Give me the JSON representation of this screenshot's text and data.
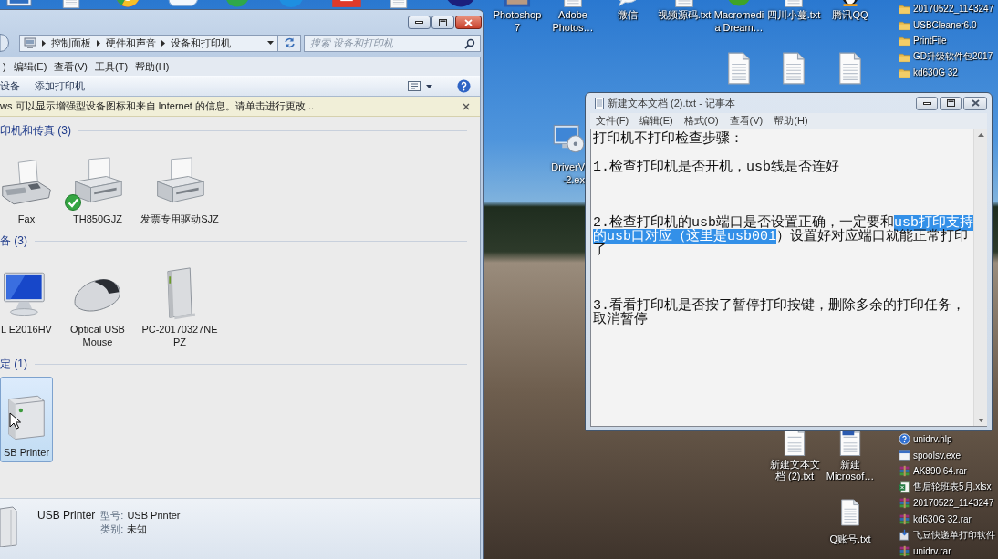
{
  "desktop": {
    "icons": [
      {
        "kind": "window"
      },
      {
        "kind": "document"
      },
      {
        "kind": "browser"
      },
      {
        "kind": "cloud"
      },
      {
        "kind": "orb",
        "color": "#2fa84a"
      },
      {
        "kind": "orb",
        "color": "#1e8fe0"
      },
      {
        "kind": "tile",
        "color": "#e03a2a"
      },
      {
        "kind": "document"
      },
      {
        "kind": "orb",
        "color": "#1b1f7c"
      },
      {
        "kind": "photo",
        "lines": [
          "Photoshop",
          "7"
        ]
      },
      {
        "kind": "document",
        "lines": [
          "Adobe",
          "Photos…"
        ]
      },
      {
        "kind": "bubble",
        "lines": [
          "微信"
        ]
      },
      {
        "kind": "document",
        "lines": [
          "视频源码.txt"
        ]
      },
      {
        "kind": "orb",
        "color": "#3fa428",
        "lines": [
          "Macromedi",
          "a Dream…"
        ]
      },
      {
        "kind": "document",
        "lines": [
          "四川小蔓.txt"
        ]
      },
      {
        "kind": "penguin",
        "lines": [
          "腾讯QQ"
        ]
      },
      {
        "kind": "document"
      },
      {
        "kind": "document"
      },
      {
        "kind": "document"
      },
      {
        "kind": "disc",
        "lines": [
          "DriverV",
          "-2.ex"
        ]
      },
      {
        "kind": "document",
        "lines": [
          "新建文本文",
          "档 (2).txt"
        ]
      },
      {
        "kind": "word",
        "lines": [
          "新建",
          "Microsof…"
        ]
      },
      {
        "kind": "document",
        "lines": [
          "Q账号.txt"
        ]
      }
    ]
  },
  "files": {
    "top": [
      {
        "kind": "folder",
        "name": "20170522_1143247"
      },
      {
        "kind": "folder",
        "name": "USBCleaner6.0"
      },
      {
        "kind": "folder",
        "name": "PrintFile"
      },
      {
        "kind": "folder",
        "name": "GD升级软件包2017"
      },
      {
        "kind": "folder",
        "name": "kd630G 32"
      }
    ],
    "bottom": [
      {
        "kind": "help",
        "name": "unidrv.hlp"
      },
      {
        "kind": "program",
        "name": "spoolsv.exe"
      },
      {
        "kind": "archive",
        "name": "AK890 64.rar"
      },
      {
        "kind": "sheet",
        "name": "售后轮班表5月.xlsx"
      },
      {
        "kind": "archive",
        "name": "20170522_1143247"
      },
      {
        "kind": "archive",
        "name": "kd630G 32.rar"
      },
      {
        "kind": "installer",
        "name": "飞豆快递单打印软件"
      },
      {
        "kind": "archive",
        "name": "unidrv.rar"
      }
    ]
  },
  "explorer": {
    "address": {
      "crumbs": [
        "控制面板",
        "硬件和声音",
        "设备和打印机"
      ]
    },
    "search": {
      "placeholder": "搜索 设备和打印机"
    },
    "menu": [
      ")",
      "编辑(E)",
      "查看(V)",
      "工具(T)",
      "帮助(H)"
    ],
    "toolbar": [
      "设备",
      "添加打印机"
    ],
    "info_bar": {
      "text": "ws 可以显示增强型设备图标和来自 Internet 的信息。请单击进行更改..."
    },
    "groups": [
      {
        "title": "印机和传真 (3)",
        "devices": [
          {
            "kind": "fax",
            "lines": [
              "Fax"
            ],
            "default": false,
            "selected": false
          },
          {
            "kind": "printer",
            "lines": [
              "TH850GJZ"
            ],
            "default": true,
            "selected": false
          },
          {
            "kind": "printer",
            "lines": [
              "发票专用驱动SJZ"
            ],
            "default": false,
            "selected": false
          }
        ]
      },
      {
        "title": "备 (3)",
        "devices": [
          {
            "kind": "monitor",
            "lines": [
              "L E2016HV"
            ],
            "default": false,
            "selected": false
          },
          {
            "kind": "mouse",
            "lines": [
              "Optical USB",
              "Mouse"
            ],
            "default": false,
            "selected": false
          },
          {
            "kind": "tower",
            "lines": [
              "PC-20170327NE",
              "PZ"
            ],
            "default": false,
            "selected": false
          }
        ]
      },
      {
        "title": "定 (1)",
        "devices": [
          {
            "kind": "box",
            "lines": [
              "SB Printer"
            ],
            "default": false,
            "selected": true
          }
        ]
      }
    ],
    "details": {
      "name": "USB Printer",
      "fields": [
        {
          "label": "型号:",
          "value": "USB Printer"
        },
        {
          "label": "类别:",
          "value": "未知"
        }
      ]
    }
  },
  "notepad": {
    "title": "新建文本文档 (2).txt - 记事本",
    "menu": [
      "文件(F)",
      "编辑(E)",
      "格式(O)",
      "查看(V)",
      "帮助(H)"
    ],
    "paragraphs": [
      {
        "kind": "heading",
        "lines": [
          {
            "segments": [
              {
                "text": "打印机不打印检查步骤：",
                "selected": false
              }
            ]
          }
        ]
      },
      {
        "kind": "step",
        "lines": [
          {
            "segments": [
              {
                "text": "1.检查打印机是否开机，usb线是否连好",
                "selected": false
              }
            ]
          }
        ]
      },
      {
        "kind": "step",
        "lines": [
          {
            "segments": [
              {
                "text": "2.检查打印机的usb端口是否设置正确，一定要和",
                "selected": false
              },
              {
                "text": "usb打印支持",
                "selected": true
              }
            ]
          },
          {
            "segments": [
              {
                "text": "的usb口对应（这里是usb001",
                "selected": true
              },
              {
                "text": "）设置好对应端口就能正常打印",
                "selected": false
              }
            ]
          },
          {
            "segments": [
              {
                "text": "了",
                "selected": false
              }
            ]
          }
        ]
      },
      {
        "kind": "step",
        "lines": [
          {
            "segments": [
              {
                "text": "3.看看打印机是否按了暂停打印按键，删除多余的打印任务，",
                "selected": false
              }
            ]
          },
          {
            "segments": [
              {
                "text": "取消暂停",
                "selected": false
              }
            ]
          }
        ]
      }
    ]
  }
}
